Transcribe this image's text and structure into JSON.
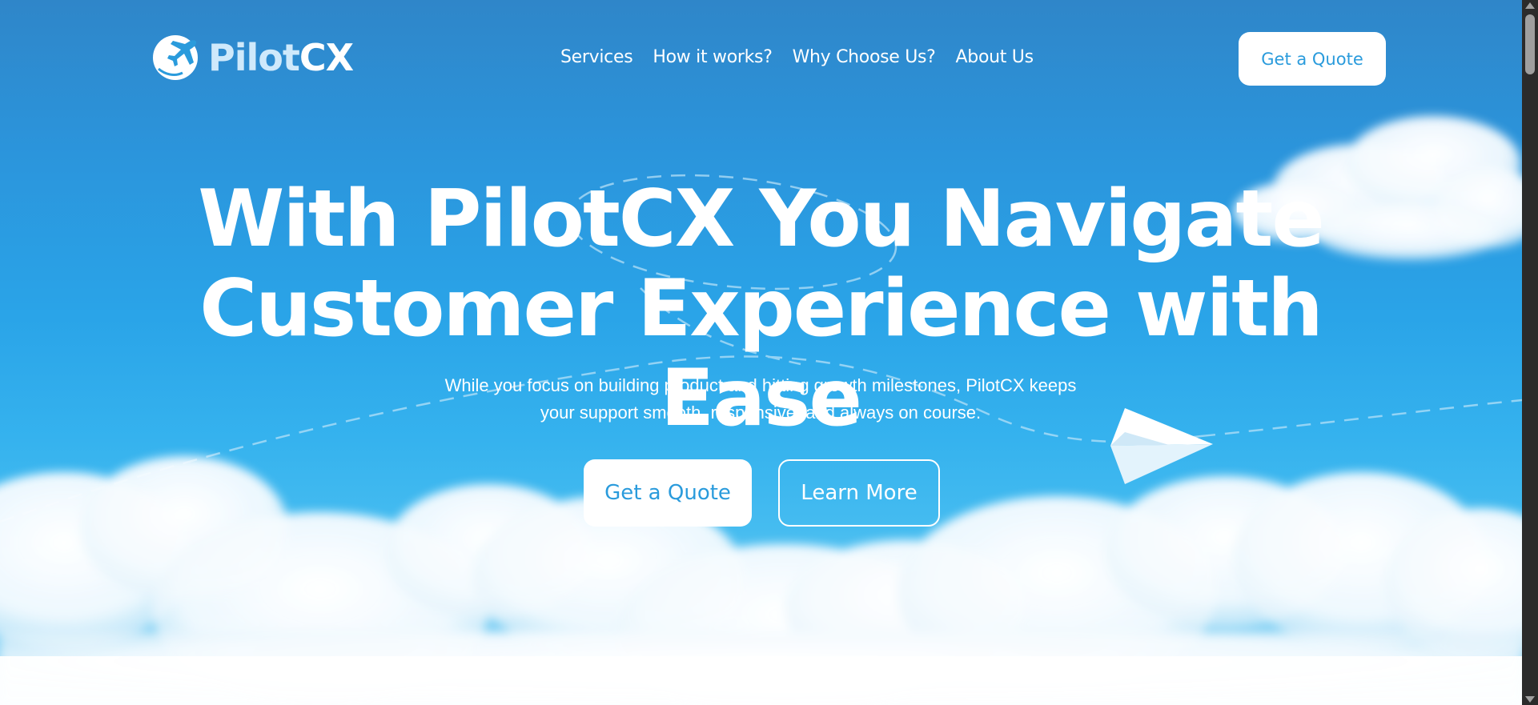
{
  "brand": {
    "name_part1": "Pilot",
    "name_part2": "CX",
    "primary_color": "#2a9bdc",
    "logo_icon": "airplane-logo-icon"
  },
  "nav": {
    "links": [
      {
        "label": "Services"
      },
      {
        "label": "How it works?"
      },
      {
        "label": "Why Choose Us?"
      },
      {
        "label": "About Us"
      }
    ],
    "cta_label": "Get a Quote"
  },
  "hero": {
    "title_line1": "With PilotCX You Navigate",
    "title_line2": "Customer Experience with Ease",
    "subtitle_line1": "While you focus on building product and hitting growth milestones, PilotCX keeps",
    "subtitle_line2": "your support smooth, responsive, and always on course.",
    "primary_button": "Get a Quote",
    "secondary_button": "Learn More",
    "decoration_icon": "paper-plane-icon"
  },
  "colors": {
    "sky_top": "#2f86c9",
    "sky_bottom": "#bfe6f8",
    "text": "#ffffff"
  }
}
